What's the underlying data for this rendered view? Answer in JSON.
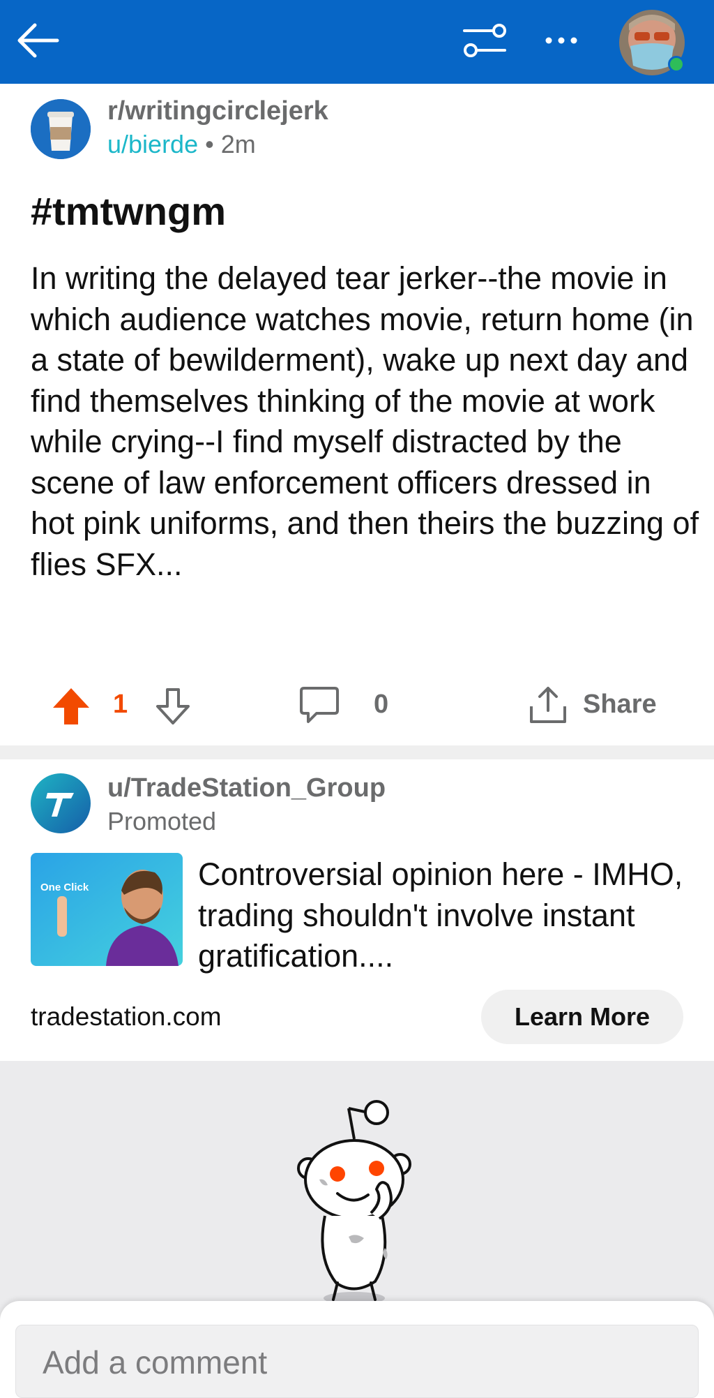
{
  "topbar": {
    "background": "#0766c6",
    "icons": [
      "back-arrow-icon",
      "filter-sliders-icon",
      "more-dots-icon"
    ]
  },
  "post": {
    "subreddit": "r/writingcirclejerk",
    "author": "u/bierde",
    "separator": "•",
    "time": "2m",
    "title": "#tmtwngm",
    "body": "In writing the delayed tear jerker--the movie in which  audience watches movie, return home (in a state of bewilderment), wake up next day and find themselves thinking of the movie at work while crying--I find myself distracted by the scene of law enforcement officers dressed in hot pink uniforms, and then theirs the buzzing of flies SFX...",
    "vote_count": "1",
    "comment_count": "0",
    "share_label": "Share",
    "upvote_color": "#f24a00"
  },
  "ad": {
    "user": "u/TradeStation_Group",
    "promoted_label": "Promoted",
    "headline": "Controversial opinion here - IMHO, trading shouldn't involve instant gratification....",
    "thumb_text": "One Click",
    "domain": "tradestation.com",
    "cta_label": "Learn More"
  },
  "comment_bar": {
    "placeholder": "Add a comment"
  }
}
